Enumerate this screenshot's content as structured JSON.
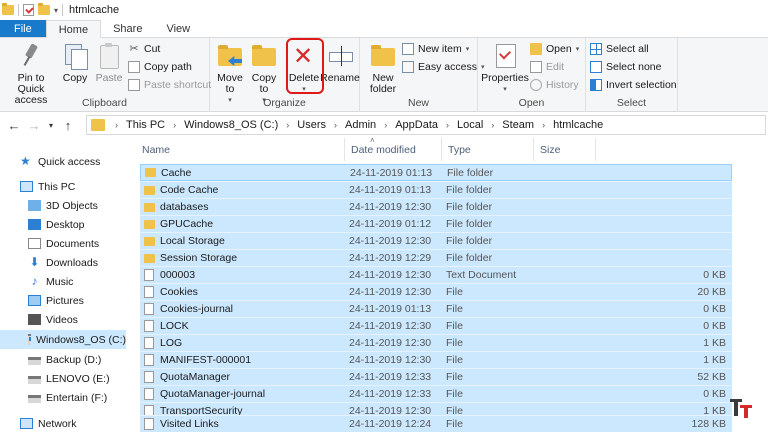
{
  "window": {
    "title": "htmlcache"
  },
  "ribbon": {
    "tabs": {
      "file": "File",
      "home": "Home",
      "share": "Share",
      "view": "View"
    },
    "clipboard": {
      "label": "Clipboard",
      "pin": "Pin to Quick access",
      "copy": "Copy",
      "paste": "Paste",
      "cut": "Cut",
      "copy_path": "Copy path",
      "paste_shortcut": "Paste shortcut"
    },
    "organize": {
      "label": "Organize",
      "move_to": "Move to",
      "copy_to": "Copy to",
      "delete": "Delete",
      "rename": "Rename"
    },
    "new": {
      "label": "New",
      "new_folder": "New folder",
      "new_item": "New item",
      "easy_access": "Easy access"
    },
    "open": {
      "label": "Open",
      "properties": "Properties",
      "open": "Open",
      "edit": "Edit",
      "history": "History"
    },
    "select": {
      "label": "Select",
      "select_all": "Select all",
      "select_none": "Select none",
      "invert": "Invert selection"
    },
    "highlight_color": "#e01818"
  },
  "address": {
    "crumbs": [
      "This PC",
      "Windows8_OS (C:)",
      "Users",
      "Admin",
      "AppData",
      "Local",
      "Steam",
      "htmlcache"
    ]
  },
  "nav": {
    "items": [
      {
        "label": "Quick access",
        "icon": "star-icon"
      },
      {
        "label": "This PC",
        "icon": "computer-icon"
      },
      {
        "label": "3D Objects",
        "icon": "3d-objects-icon"
      },
      {
        "label": "Desktop",
        "icon": "desktop-icon"
      },
      {
        "label": "Documents",
        "icon": "documents-icon"
      },
      {
        "label": "Downloads",
        "icon": "downloads-icon"
      },
      {
        "label": "Music",
        "icon": "music-icon"
      },
      {
        "label": "Pictures",
        "icon": "pictures-icon"
      },
      {
        "label": "Videos",
        "icon": "videos-icon"
      },
      {
        "label": "Windows8_OS (C:)",
        "icon": "drive-icon"
      },
      {
        "label": "Backup (D:)",
        "icon": "drive-icon"
      },
      {
        "label": "LENOVO (E:)",
        "icon": "drive-icon"
      },
      {
        "label": "Entertain (F:)",
        "icon": "drive-icon"
      },
      {
        "label": "Network",
        "icon": "network-icon"
      }
    ]
  },
  "files": {
    "headers": {
      "name": "Name",
      "date": "Date modified",
      "type": "Type",
      "size": "Size"
    },
    "rows": [
      {
        "name": "Cache",
        "date": "24-11-2019 01:13",
        "type": "File folder",
        "size": "",
        "icon": "folder-icon"
      },
      {
        "name": "Code Cache",
        "date": "24-11-2019 01:13",
        "type": "File folder",
        "size": "",
        "icon": "folder-icon"
      },
      {
        "name": "databases",
        "date": "24-11-2019 12:30",
        "type": "File folder",
        "size": "",
        "icon": "folder-icon"
      },
      {
        "name": "GPUCache",
        "date": "24-11-2019 01:12",
        "type": "File folder",
        "size": "",
        "icon": "folder-icon"
      },
      {
        "name": "Local Storage",
        "date": "24-11-2019 12:30",
        "type": "File folder",
        "size": "",
        "icon": "folder-icon"
      },
      {
        "name": "Session Storage",
        "date": "24-11-2019 12:29",
        "type": "File folder",
        "size": "",
        "icon": "folder-icon"
      },
      {
        "name": "000003",
        "date": "24-11-2019 12:30",
        "type": "Text Document",
        "size": "0 KB",
        "icon": "document-icon"
      },
      {
        "name": "Cookies",
        "date": "24-11-2019 12:30",
        "type": "File",
        "size": "20 KB",
        "icon": "file-icon"
      },
      {
        "name": "Cookies-journal",
        "date": "24-11-2019 01:13",
        "type": "File",
        "size": "0 KB",
        "icon": "file-icon"
      },
      {
        "name": "LOCK",
        "date": "24-11-2019 12:30",
        "type": "File",
        "size": "0 KB",
        "icon": "file-icon"
      },
      {
        "name": "LOG",
        "date": "24-11-2019 12:30",
        "type": "File",
        "size": "1 KB",
        "icon": "file-icon"
      },
      {
        "name": "MANIFEST-000001",
        "date": "24-11-2019 12:30",
        "type": "File",
        "size": "1 KB",
        "icon": "file-icon"
      },
      {
        "name": "QuotaManager",
        "date": "24-11-2019 12:33",
        "type": "File",
        "size": "52 KB",
        "icon": "file-icon"
      },
      {
        "name": "QuotaManager-journal",
        "date": "24-11-2019 12:33",
        "type": "File",
        "size": "0 KB",
        "icon": "file-icon"
      },
      {
        "name": "TransportSecurity",
        "date": "24-11-2019 12:30",
        "type": "File",
        "size": "1 KB",
        "icon": "file-icon"
      },
      {
        "name": "Visited Links",
        "date": "24-11-2019 12:24",
        "type": "File",
        "size": "128 KB",
        "icon": "file-icon"
      }
    ]
  },
  "colors": {
    "selection": "#cce8ff",
    "file_tab": "#1979ca",
    "folder": "#f1c24a"
  }
}
